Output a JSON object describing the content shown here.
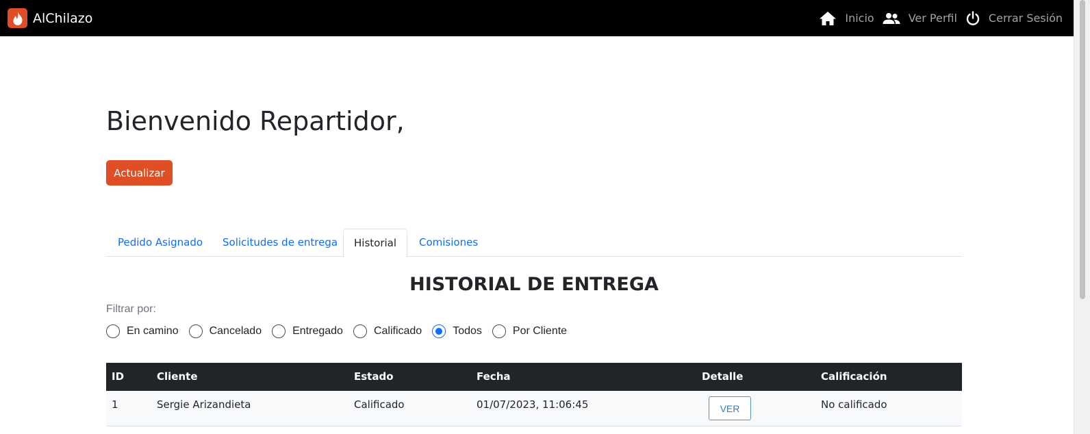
{
  "navbar": {
    "brand": "AlChilazo",
    "links": [
      {
        "label": "Inicio",
        "icon": "home-icon"
      },
      {
        "label": "Ver Perfil",
        "icon": "users-icon"
      },
      {
        "label": "Cerrar Sesión",
        "icon": "power-icon"
      }
    ]
  },
  "page": {
    "welcome": "Bienvenido Repartidor,",
    "refresh_label": "Actualizar"
  },
  "tabs": [
    {
      "label": "Pedido Asignado",
      "active": false
    },
    {
      "label": "Solicitudes de entrega",
      "active": false
    },
    {
      "label": "Historial",
      "active": true
    },
    {
      "label": "Comisiones",
      "active": false
    }
  ],
  "history": {
    "title": "HISTORIAL DE ENTREGA",
    "filter_label": "Filtrar por:",
    "filters": [
      {
        "label": "En camino",
        "checked": false
      },
      {
        "label": "Cancelado",
        "checked": false
      },
      {
        "label": "Entregado",
        "checked": false
      },
      {
        "label": "Calificado",
        "checked": false
      },
      {
        "label": "Todos",
        "checked": true
      },
      {
        "label": "Por Cliente",
        "checked": false
      }
    ],
    "columns": [
      "ID",
      "Cliente",
      "Estado",
      "Fecha",
      "Detalle",
      "Calificación"
    ],
    "rows": [
      {
        "id": "1",
        "cliente": "Sergie Arizandieta",
        "estado": "Calificado",
        "fecha": "01/07/2023, 11:06:45",
        "detalle": "VER",
        "calificacion": "No calificado"
      }
    ]
  },
  "colors": {
    "brand": "#e04e26",
    "link": "#0d6efd",
    "navbar": "#000000",
    "table_header": "#212529"
  }
}
